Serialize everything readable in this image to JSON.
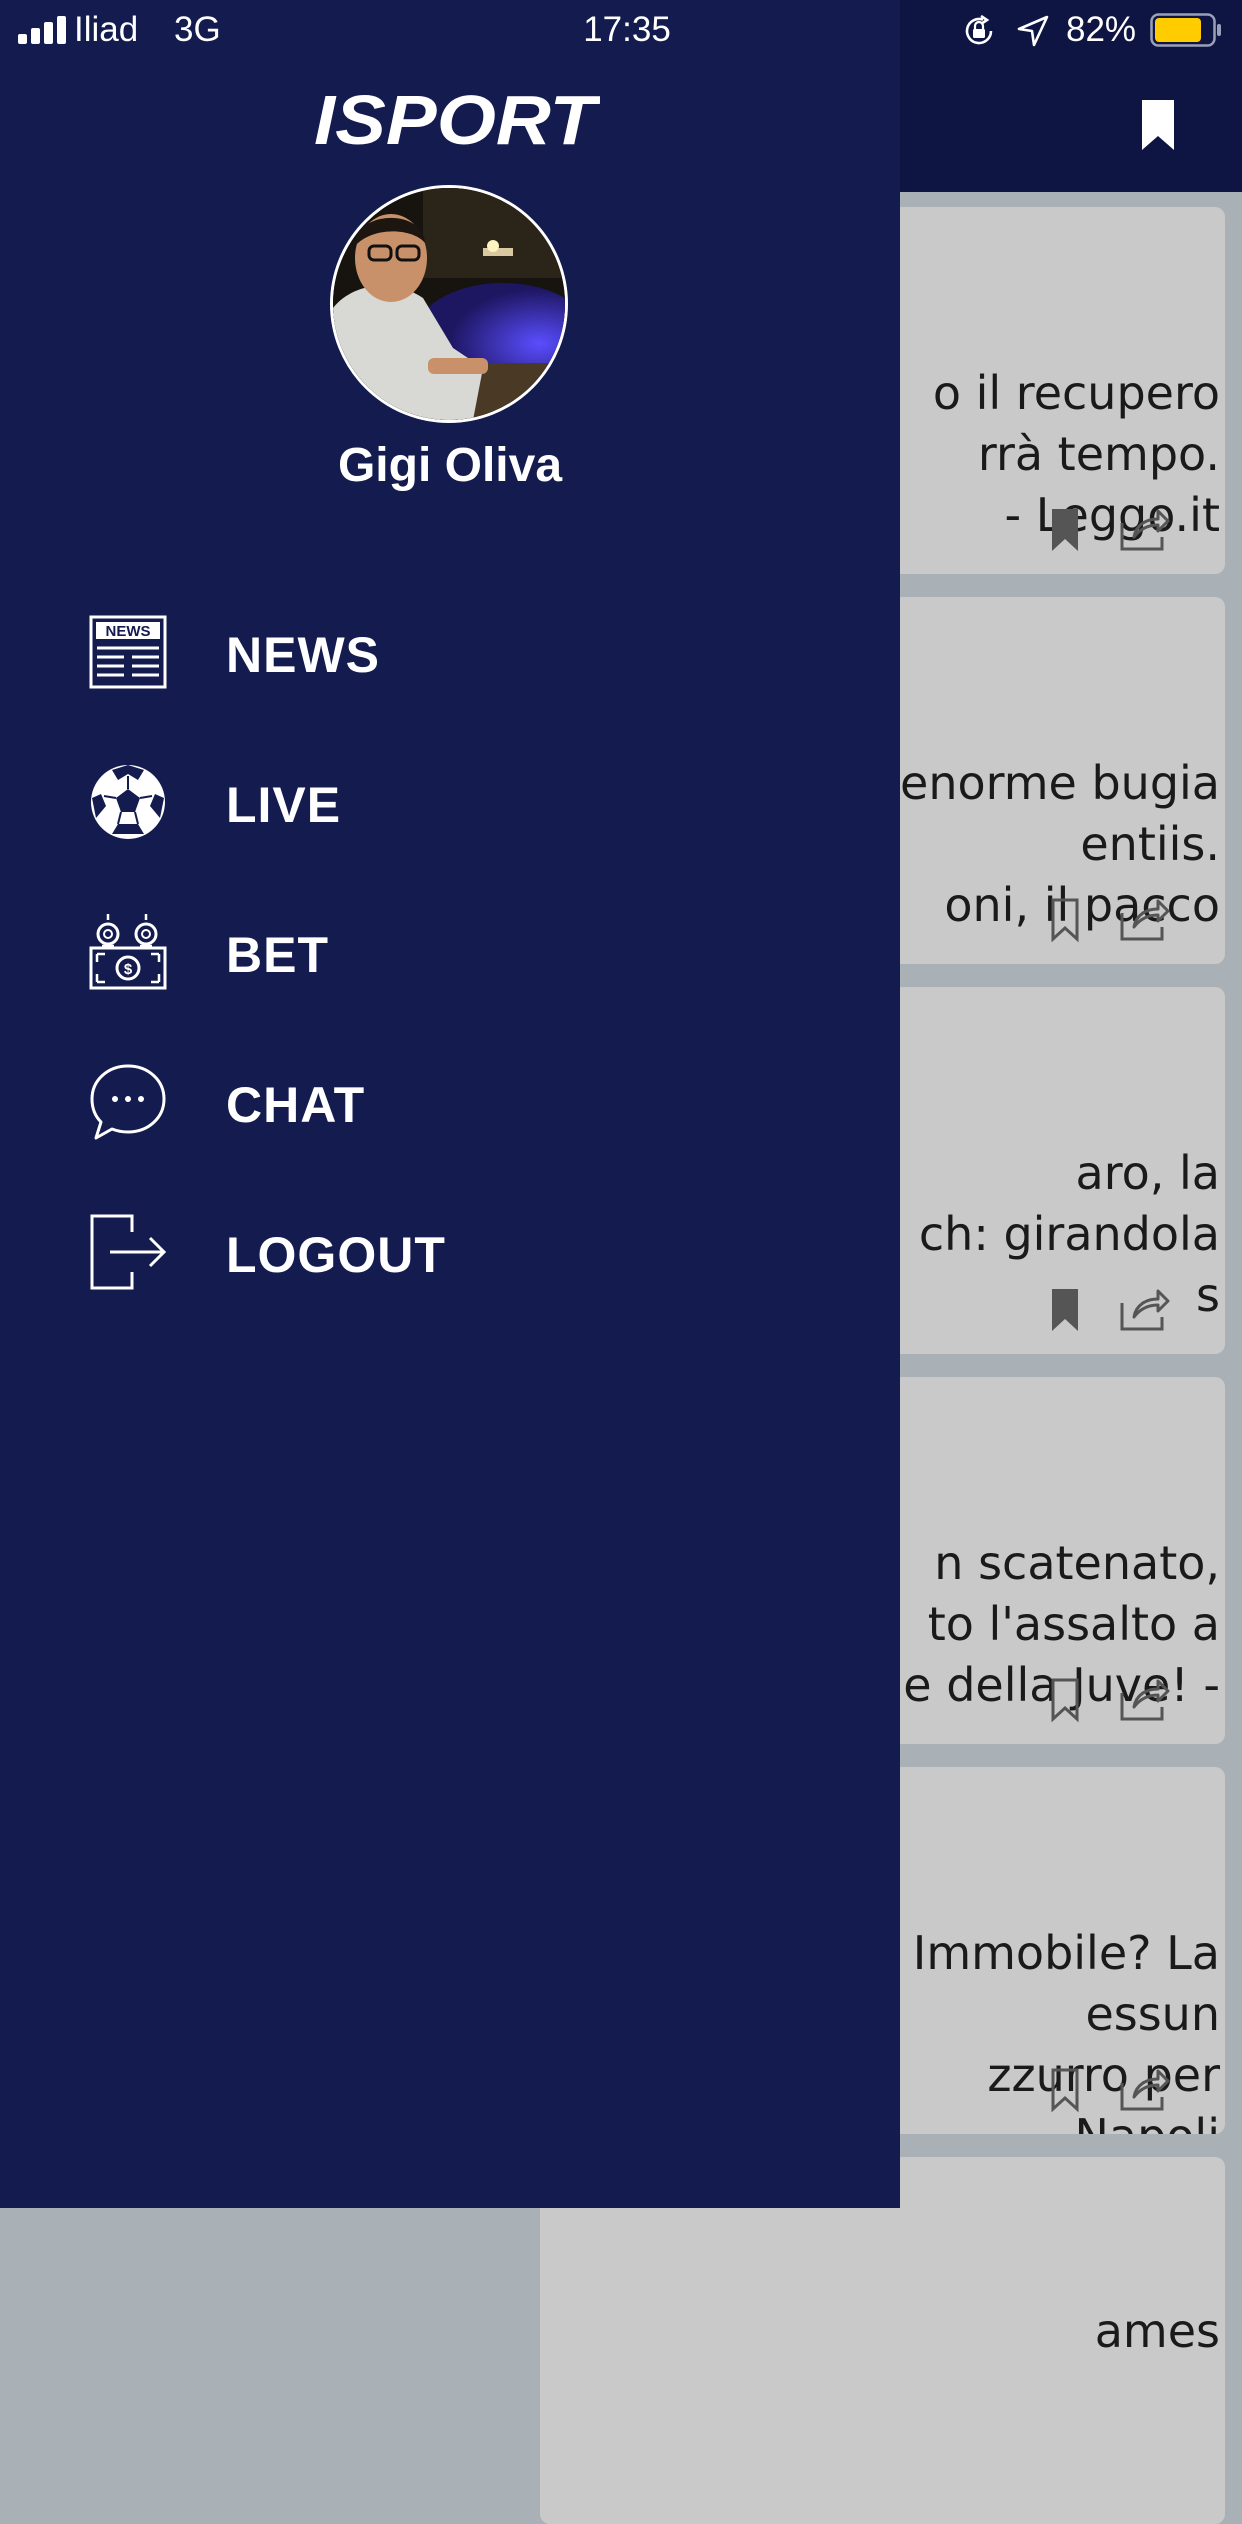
{
  "status_bar": {
    "carrier": "Iliad",
    "network": "3G",
    "time": "17:35",
    "battery_percent": "82%",
    "battery_level": 0.82,
    "battery_color": "#ffcc00",
    "icons": [
      "signal-icon",
      "rotation-lock-icon",
      "location-arrow-icon",
      "battery-icon"
    ]
  },
  "drawer": {
    "background_color": "#141b4f",
    "logo_text": "ISPORT",
    "user": {
      "name": "Gigi Oliva"
    },
    "menu": [
      {
        "label": "NEWS",
        "icon": "newspaper-icon"
      },
      {
        "label": "LIVE",
        "icon": "soccer-ball-icon"
      },
      {
        "label": "BET",
        "icon": "money-bet-icon"
      },
      {
        "label": "CHAT",
        "icon": "chat-bubble-icon"
      },
      {
        "label": "LOGOUT",
        "icon": "logout-icon"
      }
    ]
  },
  "feed": {
    "header_color": "#0e1543",
    "header_icon": "bookmark-icon",
    "articles": [
      {
        "lines": [
          "o il recupero",
          "rrà tempo.",
          "- Leggo.it"
        ],
        "bookmarked": true
      },
      {
        "lines": [
          "enorme bugia",
          "entiis.",
          "oni, il pacco"
        ],
        "bookmarked": false
      },
      {
        "lines": [
          "aro, la",
          "ch: girandola",
          "s"
        ],
        "bookmarked": true
      },
      {
        "lines": [
          "n scatenato,",
          "to l'assalto a",
          "e della Juve! -"
        ],
        "bookmarked": false
      },
      {
        "lines": [
          "Immobile? La",
          "essun",
          "zzurro per",
          "Napoli"
        ],
        "bookmarked": false
      },
      {
        "lines": [
          "ames"
        ],
        "bookmarked": false
      }
    ]
  }
}
